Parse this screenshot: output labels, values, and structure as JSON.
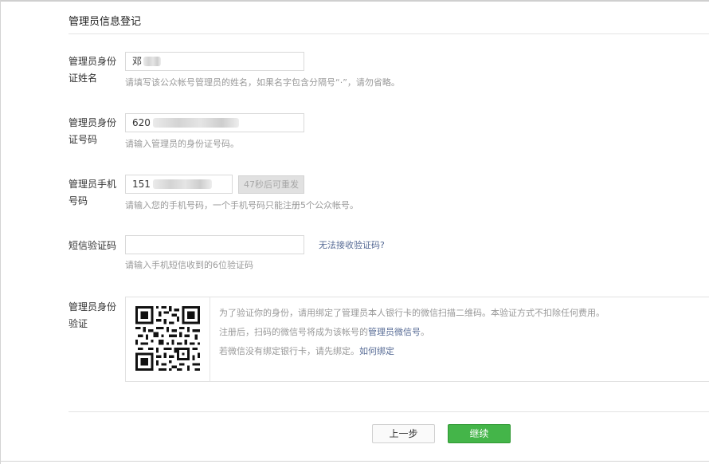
{
  "section_title": "管理员信息登记",
  "fields": {
    "name": {
      "label": "管理员身份证姓名",
      "value": "邓",
      "hint": "请填写该公众帐号管理员的姓名，如果名字包含分隔号“·”，请勿省略。"
    },
    "id_number": {
      "label": "管理员身份证号码",
      "value": "620",
      "hint": "请输入管理员的身份证号码。"
    },
    "phone": {
      "label": "管理员手机号码",
      "value": "151",
      "resend_label": "47秒后可重发",
      "hint": "请输入您的手机号码，一个手机号码只能注册5个公众帐号。"
    },
    "sms_code": {
      "label": "短信验证码",
      "value": "",
      "cannot_receive_link": "无法接收验证码?",
      "hint": "请输入手机短信收到的6位验证码"
    },
    "identity_verify": {
      "label": "管理员身份验证",
      "line1": "为了验证你的身份，请用绑定了管理员本人银行卡的微信扫描二维码。本验证方式不扣除任何费用。",
      "line2_prefix": "注册后，扫码的微信号将成为该帐号的",
      "line2_strong": "管理员微信号",
      "line2_suffix": "。",
      "line3_prefix": "若微信没有绑定银行卡，请先绑定。",
      "line3_link": "如何绑定"
    }
  },
  "buttons": {
    "prev": "上一步",
    "next": "继续"
  },
  "colors": {
    "accent_green": "#44b549",
    "link_blue": "#576b95",
    "hint_gray": "#999999"
  }
}
